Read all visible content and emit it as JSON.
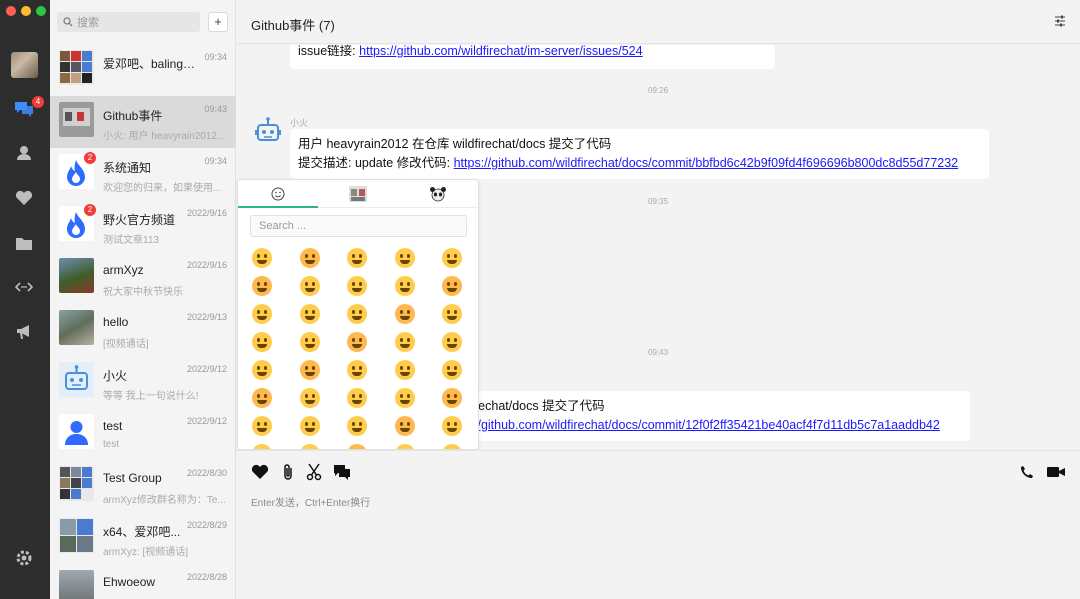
{
  "window": {
    "traffic_lights": [
      "#fe5f57",
      "#febc2e",
      "#28c840"
    ]
  },
  "rail": {
    "icons": [
      "chat-icon",
      "contacts-icon",
      "favorites-icon",
      "folder-icon",
      "workspace-icon",
      "channel-icon",
      "settings-icon"
    ],
    "unread_badge": "4"
  },
  "conversation_list": {
    "search_placeholder": "搜索",
    "add_label": "+",
    "items": [
      {
        "name": "爱邓吧、balingdu...",
        "time": "09:34",
        "last": "",
        "badge": ""
      },
      {
        "name": "Github事件",
        "time": "09:43",
        "last": "小火: 用户 heavyrain2012...",
        "badge": ""
      },
      {
        "name": "系统通知",
        "time": "09:34",
        "last": "欢迎您的归来，如果使用...",
        "badge": "2"
      },
      {
        "name": "野火官方频道",
        "time": "2022/9/16",
        "last": "测试文章113",
        "badge": "2"
      },
      {
        "name": "armXyz",
        "time": "2022/9/16",
        "last": "祝大家中秋节快乐",
        "badge": ""
      },
      {
        "name": "hello",
        "time": "2022/9/13",
        "last": "[视频通话]",
        "badge": ""
      },
      {
        "name": "小火",
        "time": "2022/9/12",
        "last": "等等 我上一句说什么!",
        "badge": ""
      },
      {
        "name": "test",
        "time": "2022/9/12",
        "last": "test",
        "badge": ""
      },
      {
        "name": "Test Group",
        "time": "2022/8/30",
        "last": "armXyz修改群名称为：Te...",
        "badge": ""
      },
      {
        "name": "x64、爱邓吧...",
        "time": "2022/8/29",
        "last": "armXyz: [视频通话]",
        "badge": ""
      },
      {
        "name": "Ehwoeow",
        "time": "2022/8/28",
        "last": "",
        "badge": ""
      }
    ]
  },
  "chat": {
    "title": "Github事件 (7)",
    "msg0": {
      "prefix": "issue链接: ",
      "link": "https://github.com/wildfirechat/im-server/issues/524"
    },
    "ts1": "09:26",
    "sender": "小火",
    "msg1": {
      "line1": "用户 heavyrain2012 在仓库 wildfirechat/docs 提交了代码",
      "line2_prefix": "提交描述: update 修改代码: ",
      "link": "https://github.com/wildfirechat/docs/commit/bbfbd6c42b9f09fd4f696696b800dc8d55d77232"
    },
    "ts2": "09:35",
    "ts3": "09:43",
    "msg3": {
      "line1": "rechat/docs 提交了代码",
      "link": "//github.com/wildfirechat/docs/commit/12f0f2ff35421be40acf4f7d11db5c7a1aaddb42"
    }
  },
  "emoji_picker": {
    "tabs": [
      "smile-icon",
      "sticker-icon",
      "panda-icon"
    ],
    "search_placeholder": "Search ...",
    "emoji_rows": 8,
    "emoji_cols": 5
  },
  "composer": {
    "tools": [
      "heart-icon",
      "attachment-icon",
      "scissors-icon",
      "message-icon"
    ],
    "call_tools": [
      "phone-icon",
      "video-icon"
    ],
    "hint": "Enter发送，Ctrl+Enter换行"
  }
}
